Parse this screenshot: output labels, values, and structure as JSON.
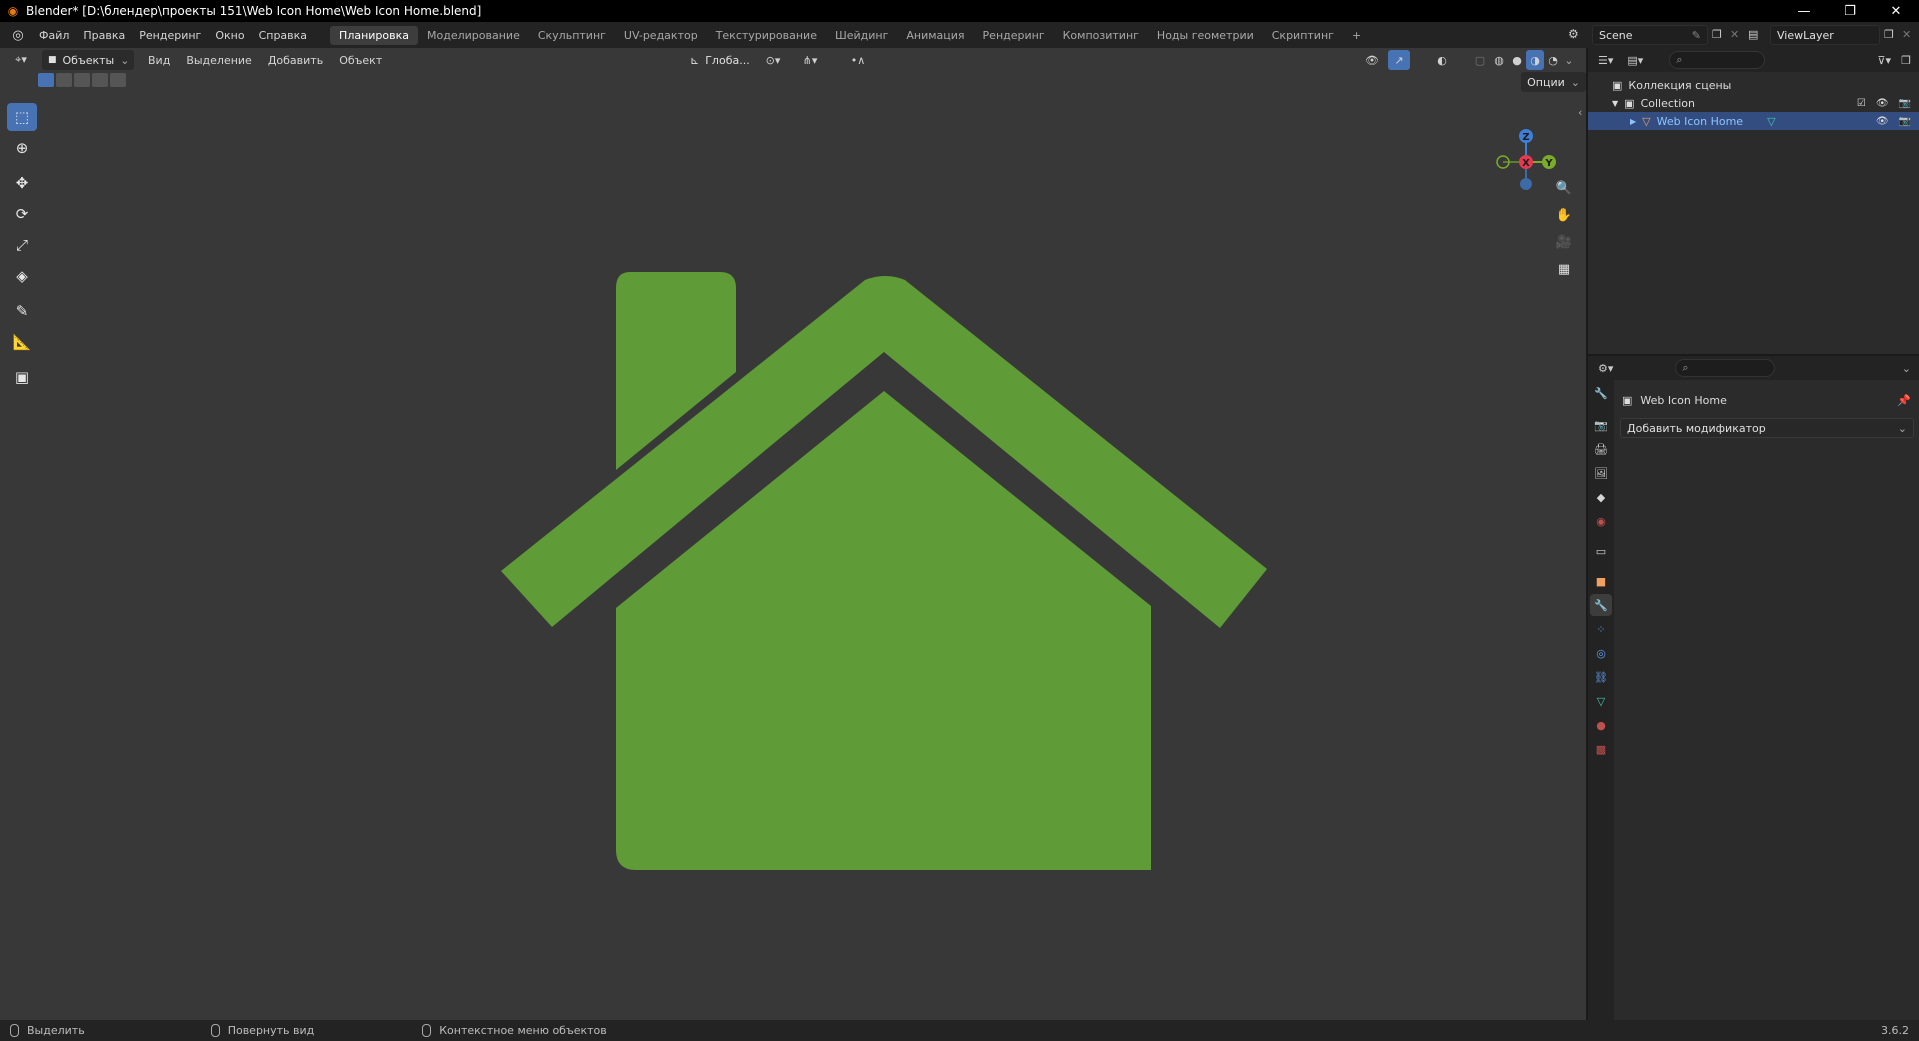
{
  "window": {
    "title": "Blender* [D:\\блендер\\проекты 151\\Web Icon Home\\Web Icon Home.blend]",
    "minimize": "—",
    "restore": "❐",
    "close": "✕"
  },
  "menu": {
    "items": [
      "Файл",
      "Правка",
      "Рендеринг",
      "Окно",
      "Справка"
    ]
  },
  "workspaces": [
    {
      "label": "Планировка",
      "active": true
    },
    {
      "label": "Моделирование",
      "active": false
    },
    {
      "label": "Скульптинг",
      "active": false
    },
    {
      "label": "UV-редактор",
      "active": false
    },
    {
      "label": "Текстурирование",
      "active": false
    },
    {
      "label": "Шейдинг",
      "active": false
    },
    {
      "label": "Анимация",
      "active": false
    },
    {
      "label": "Рендеринг",
      "active": false
    },
    {
      "label": "Композитинг",
      "active": false
    },
    {
      "label": "Ноды геометрии",
      "active": false
    },
    {
      "label": "Скриптинг",
      "active": false
    }
  ],
  "add_workspace": "+",
  "scene": {
    "value": "Scene"
  },
  "view_layer": {
    "value": "ViewLayer"
  },
  "viewport": {
    "mode": "Объекты",
    "menus": [
      "Вид",
      "Выделение",
      "Добавить",
      "Объект"
    ],
    "orientation": "Глоба...",
    "options": "Опции",
    "object_color": "#5f9b36",
    "background_color": "#383838"
  },
  "gizmo": {
    "x": "X",
    "y": "Y",
    "z": "Z"
  },
  "outliner": {
    "scene_collection": "Коллекция сцены",
    "collection": "Collection",
    "object": "Web Icon Home"
  },
  "properties": {
    "object_name": "Web Icon Home",
    "add_modifier": "Добавить модификатор"
  },
  "status": {
    "select": "Выделить",
    "rotate_view": "Повернуть вид",
    "context_menu": "Контекстное меню объектов",
    "version": "3.6.2"
  }
}
